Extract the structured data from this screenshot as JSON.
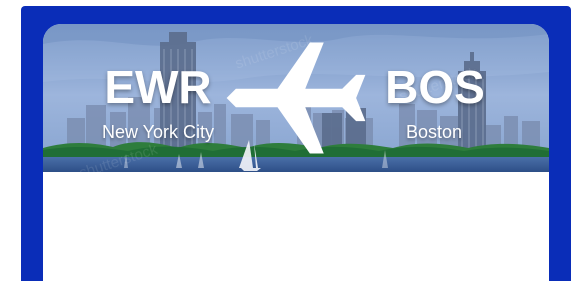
{
  "route": {
    "origin": {
      "code": "EWR",
      "city": "New York City"
    },
    "destination": {
      "code": "BOS",
      "city": "Boston"
    }
  },
  "icons": {
    "route_icon": "airplane-icon"
  },
  "colors": {
    "frame": "#0a2db8",
    "card": "#ffffff",
    "text": "#ffffff"
  }
}
